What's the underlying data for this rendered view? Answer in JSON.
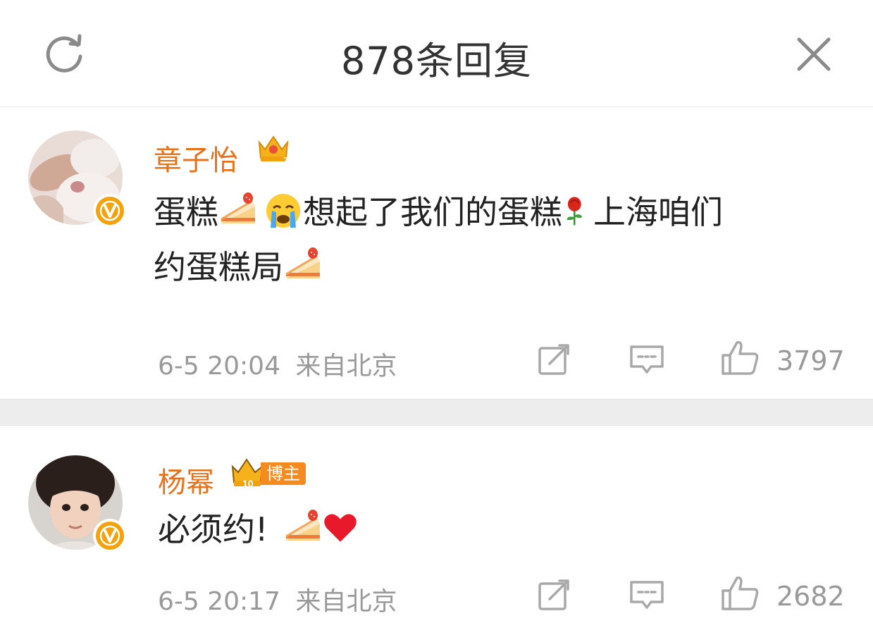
{
  "header": {
    "title": "878条回复",
    "refresh_icon": "refresh-icon",
    "close_icon": "close-icon"
  },
  "comments": [
    {
      "author": "章子怡",
      "text_line1_a": "蛋糕",
      "text_line1_b": "想起了我们的蛋糕",
      "text_line1_c": "上海咱们",
      "text_line2": "约蛋糕局",
      "time": "6-5 20:04",
      "location": "来自北京",
      "likes": "3797",
      "badge": "verified-v-badge"
    },
    {
      "author": "杨幂",
      "author_tag": "博主",
      "text": "必须约!",
      "time": "6-5 20:17",
      "location": "来自北京",
      "likes": "2682",
      "badge": "verified-v-badge"
    }
  ],
  "colors": {
    "accent_name": "#e8721a",
    "meta_gray": "#999999",
    "separator": "#ededed",
    "verified": "#f5a10a"
  }
}
